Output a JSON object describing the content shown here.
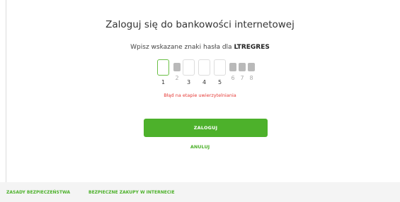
{
  "page": {
    "title": "Zaloguj się do bankowości internetowej",
    "subtitle_prefix": "Wpisz wskazane znaki hasła dla ",
    "username": "LTREGRES"
  },
  "mask": {
    "positions": [
      {
        "index": "1",
        "enabled": true,
        "active": true
      },
      {
        "index": "2",
        "enabled": false
      },
      {
        "index": "3",
        "enabled": true
      },
      {
        "index": "4",
        "enabled": true
      },
      {
        "index": "5",
        "enabled": true
      },
      {
        "index": "6",
        "enabled": false
      },
      {
        "index": "7",
        "enabled": false
      },
      {
        "index": "8",
        "enabled": false
      }
    ]
  },
  "error": {
    "message": "Błąd na etapie uwierzytelniania",
    "color": "#e53935"
  },
  "actions": {
    "login_label": "ZALOGUJ",
    "cancel_label": "ANULUJ"
  },
  "footer": {
    "links": [
      "ZASADY BEZPIECZEŃSTWA",
      "BEZPIECZNE ZAKUPY W INTERNECIE"
    ]
  },
  "colors": {
    "accent": "#4db12b",
    "error": "#e53935"
  }
}
